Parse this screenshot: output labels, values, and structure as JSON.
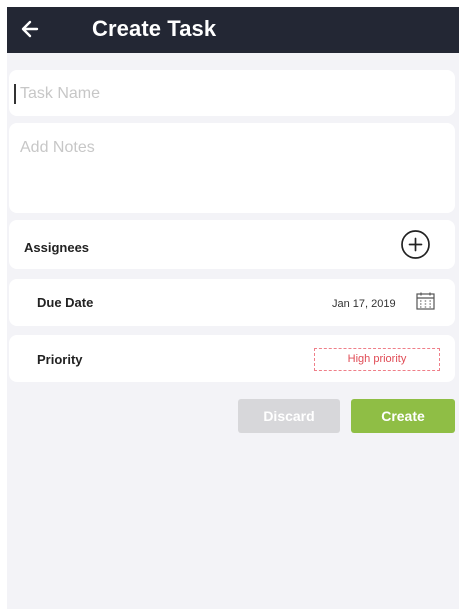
{
  "header": {
    "title": "Create Task",
    "back_icon": "arrow-left-icon"
  },
  "form": {
    "task_name": {
      "placeholder": "Task Name",
      "value": ""
    },
    "notes": {
      "placeholder": "Add Notes",
      "value": ""
    },
    "assignees": {
      "label": "Assignees",
      "add_icon": "plus-circle-icon"
    },
    "due_date": {
      "label": "Due Date",
      "value": "Jan 17, 2019",
      "icon": "calendar-icon"
    },
    "priority": {
      "label": "Priority",
      "value": "High priority"
    }
  },
  "actions": {
    "discard_label": "Discard",
    "create_label": "Create"
  },
  "colors": {
    "header_bg": "#232734",
    "page_bg": "#f3f3f7",
    "card_bg": "#ffffff",
    "accent_green": "#8fbe45",
    "discard_gray": "#d7d7da",
    "priority_red": "#e04b55"
  }
}
